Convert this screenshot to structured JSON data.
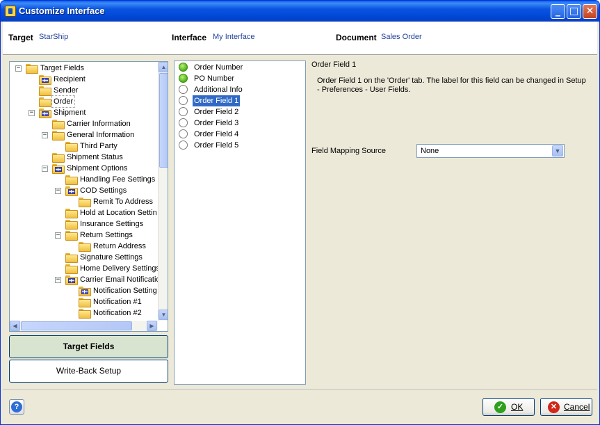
{
  "window": {
    "title": "Customize Interface"
  },
  "header": {
    "target_label": "Target",
    "target_value": "StarShip",
    "interface_label": "Interface",
    "interface_value": "My Interface",
    "document_label": "Document",
    "document_value": "Sales Order"
  },
  "tree": {
    "items": [
      {
        "label": "Target Fields",
        "icon": "folder-icon",
        "expander": "−"
      },
      {
        "label": "Recipient",
        "icon": "grid-folder-icon"
      },
      {
        "label": "Sender",
        "icon": "folder-icon"
      },
      {
        "label": "Order",
        "icon": "folder-icon"
      },
      {
        "label": "Shipment",
        "icon": "grid-folder-icon",
        "expander": "−"
      },
      {
        "label": "Carrier Information",
        "icon": "folder-icon"
      },
      {
        "label": "General Information",
        "icon": "folder-icon",
        "expander": "−"
      },
      {
        "label": "Third Party",
        "icon": "folder-icon"
      },
      {
        "label": "Shipment Status",
        "icon": "folder-icon"
      },
      {
        "label": "Shipment Options",
        "icon": "grid-folder-icon",
        "expander": "−"
      },
      {
        "label": "Handling Fee Settings",
        "icon": "folder-icon"
      },
      {
        "label": "COD Settings",
        "icon": "grid-folder-icon",
        "expander": "−"
      },
      {
        "label": "Remit To Address",
        "icon": "folder-icon"
      },
      {
        "label": "Hold at Location Settin",
        "icon": "folder-icon"
      },
      {
        "label": "Insurance Settings",
        "icon": "folder-icon"
      },
      {
        "label": "Return Settings",
        "icon": "folder-icon",
        "expander": "−"
      },
      {
        "label": "Return Address",
        "icon": "folder-icon"
      },
      {
        "label": "Signature Settings",
        "icon": "folder-icon"
      },
      {
        "label": "Home Delivery Settings",
        "icon": "folder-icon"
      },
      {
        "label": "Carrier Email Notificatio",
        "icon": "grid-folder-icon",
        "expander": "−"
      },
      {
        "label": "Notification Setting",
        "icon": "grid-folder-icon"
      },
      {
        "label": "Notification #1",
        "icon": "folder-icon"
      },
      {
        "label": "Notification #2",
        "icon": "folder-icon"
      }
    ]
  },
  "panel_buttons": {
    "target_fields": "Target Fields",
    "write_back": "Write-Back Setup"
  },
  "fields": [
    {
      "label": "Order Number",
      "mapped": true
    },
    {
      "label": "PO Number",
      "mapped": true
    },
    {
      "label": "Additional Info",
      "mapped": false
    },
    {
      "label": "Order Field 1",
      "mapped": false,
      "selected": true
    },
    {
      "label": "Order Field 2",
      "mapped": false
    },
    {
      "label": "Order Field 3",
      "mapped": false
    },
    {
      "label": "Order Field 4",
      "mapped": false
    },
    {
      "label": "Order Field 5",
      "mapped": false
    }
  ],
  "detail": {
    "title": "Order Field 1",
    "description": "Order Field 1 on the 'Order' tab. The label for this field can be changed in Setup - Preferences - User Fields.",
    "mapping_label": "Field Mapping Source",
    "mapping_value": "None"
  },
  "footer": {
    "help": "?",
    "ok_label": "OK",
    "cancel_label": "Cancel"
  },
  "colors": {
    "title_bar": "#0a53e0",
    "selected": "#316ac5",
    "mapped": "#4fb018"
  }
}
